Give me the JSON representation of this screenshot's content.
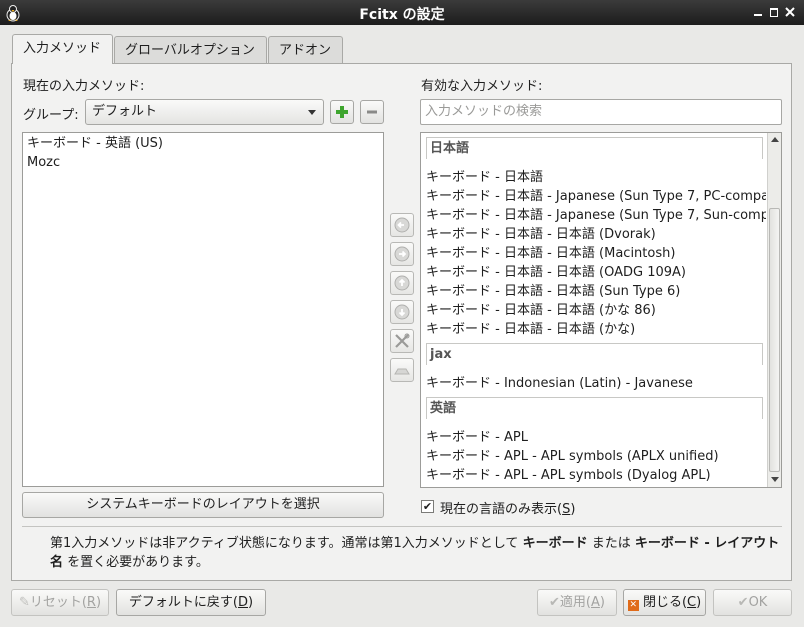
{
  "window": {
    "title": "Fcitx の設定"
  },
  "tabs": [
    {
      "label": "入力メソッド"
    },
    {
      "label": "グローバルオプション"
    },
    {
      "label": "アドオン"
    }
  ],
  "current": {
    "heading": "現在の入力メソッド:",
    "group_label": "グループ:",
    "group_value": "デフォルト",
    "items": [
      "キーボード - 英語 (US)",
      "Mozc"
    ]
  },
  "available": {
    "heading": "有効な入力メソッド:",
    "search_placeholder": "入力メソッドの検索",
    "groups": [
      {
        "name": "日本語",
        "items": [
          "キーボード - 日本語",
          "キーボード - 日本語 - Japanese (Sun Type 7, PC-compa…",
          "キーボード - 日本語 - Japanese (Sun Type 7, Sun-comp…",
          "キーボード - 日本語 - 日本語 (Dvorak)",
          "キーボード - 日本語 - 日本語 (Macintosh)",
          "キーボード - 日本語 - 日本語 (OADG 109A)",
          "キーボード - 日本語 - 日本語 (Sun Type 6)",
          "キーボード - 日本語 - 日本語 (かな 86)",
          "キーボード - 日本語 - 日本語 (かな)"
        ]
      },
      {
        "name": "jax",
        "items": [
          "キーボード - Indonesian (Latin) - Javanese"
        ]
      },
      {
        "name": "英語",
        "items": [
          "キーボード - APL",
          "キーボード - APL - APL symbols (APLX unified)",
          "キーボード - APL - APL symbols (Dyalog APL)"
        ]
      }
    ]
  },
  "select_layout_button": "システムキーボードのレイアウトを選択",
  "only_current_lang": {
    "label": "現在の言語のみ表示(",
    "key": "S",
    "suffix": ")",
    "checked": true
  },
  "info": {
    "text1": "第1入力メソッドは非アクティブ状態になります。通常は第1入力メソッドとして ",
    "bold1": "キーボード",
    "text2": " または ",
    "bold2": "キーボード - レイアウト名",
    "text3": " を置く必要があります。"
  },
  "buttons": {
    "reset": {
      "label": "リセット(",
      "key": "R",
      "suffix": ")"
    },
    "defaults": {
      "label": "デフォルトに戻す(",
      "key": "D",
      "suffix": ")"
    },
    "apply": {
      "label": "適用(",
      "key": "A",
      "suffix": ")"
    },
    "close": {
      "label": "閉じる(",
      "key": "C",
      "suffix": ")"
    },
    "ok": {
      "label": "OK",
      "key": "",
      "suffix": ""
    }
  },
  "icons": {
    "add": "plus-icon",
    "remove": "minus-icon",
    "left": "arrow-left-icon",
    "right": "arrow-right-icon",
    "up": "arrow-up-icon",
    "down": "arrow-down-icon",
    "configure": "wrench-screwdriver-icon",
    "keyboard": "keyboard-icon"
  },
  "colors": {
    "titlebar": "#2a2a2a",
    "add_icon": "#3ea52e",
    "close_icon": "#e06b1a"
  }
}
